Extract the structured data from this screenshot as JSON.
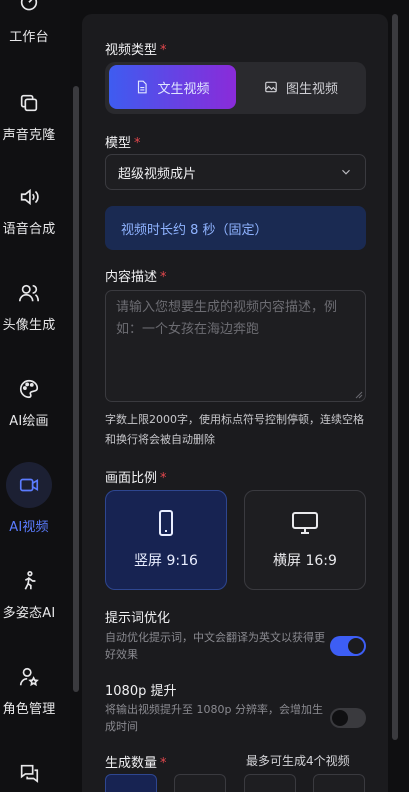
{
  "sidebar": {
    "items": [
      {
        "label": "工作台",
        "icon": "workbench-icon"
      },
      {
        "label": "声音克隆",
        "icon": "copy-icon"
      },
      {
        "label": "语音合成",
        "icon": "speaker-icon"
      },
      {
        "label": "头像生成",
        "icon": "users-icon"
      },
      {
        "label": "AI绘画",
        "icon": "palette-icon"
      },
      {
        "label": "AI视频",
        "icon": "video-icon",
        "active": true
      },
      {
        "label": "多姿态AI",
        "icon": "pose-icon"
      },
      {
        "label": "角色管理",
        "icon": "user-star-icon"
      },
      {
        "label": "",
        "icon": "chat-icon"
      }
    ]
  },
  "form": {
    "video_type": {
      "label": "视频类型",
      "options": [
        {
          "label": "文生视频",
          "icon": "document-icon",
          "selected": true
        },
        {
          "label": "图生视频",
          "icon": "image-icon",
          "selected": false
        }
      ]
    },
    "model": {
      "label": "模型",
      "value": "超级视频成片"
    },
    "duration_note": "视频时长约 8 秒（固定）",
    "description": {
      "label": "内容描述",
      "placeholder": "请输入您想要生成的视频内容描述，例如：一个女孩在海边奔跑",
      "hint": "字数上限2000字，使用标点符号控制停顿，连续空格和换行将会被自动删除"
    },
    "aspect_ratio": {
      "label": "画面比例",
      "options": [
        {
          "label": "竖屏 9:16",
          "icon": "phone-icon",
          "selected": true
        },
        {
          "label": "横屏 16:9",
          "icon": "monitor-icon",
          "selected": false
        }
      ]
    },
    "prompt_optimize": {
      "title": "提示词优化",
      "description": "自动优化提示词，中文会翻译为英文以获得更好效果",
      "enabled": true
    },
    "hd_1080p": {
      "title": "1080p 提升",
      "description": "将输出视频提升至 1080p 分辨率，会增加生成时间",
      "enabled": false
    },
    "count": {
      "label": "生成数量",
      "max_note": "最多可生成4个视频"
    }
  },
  "colors": {
    "accent": "#3d5ef5",
    "required": "#e5484d",
    "active_text": "#5b7cff"
  }
}
